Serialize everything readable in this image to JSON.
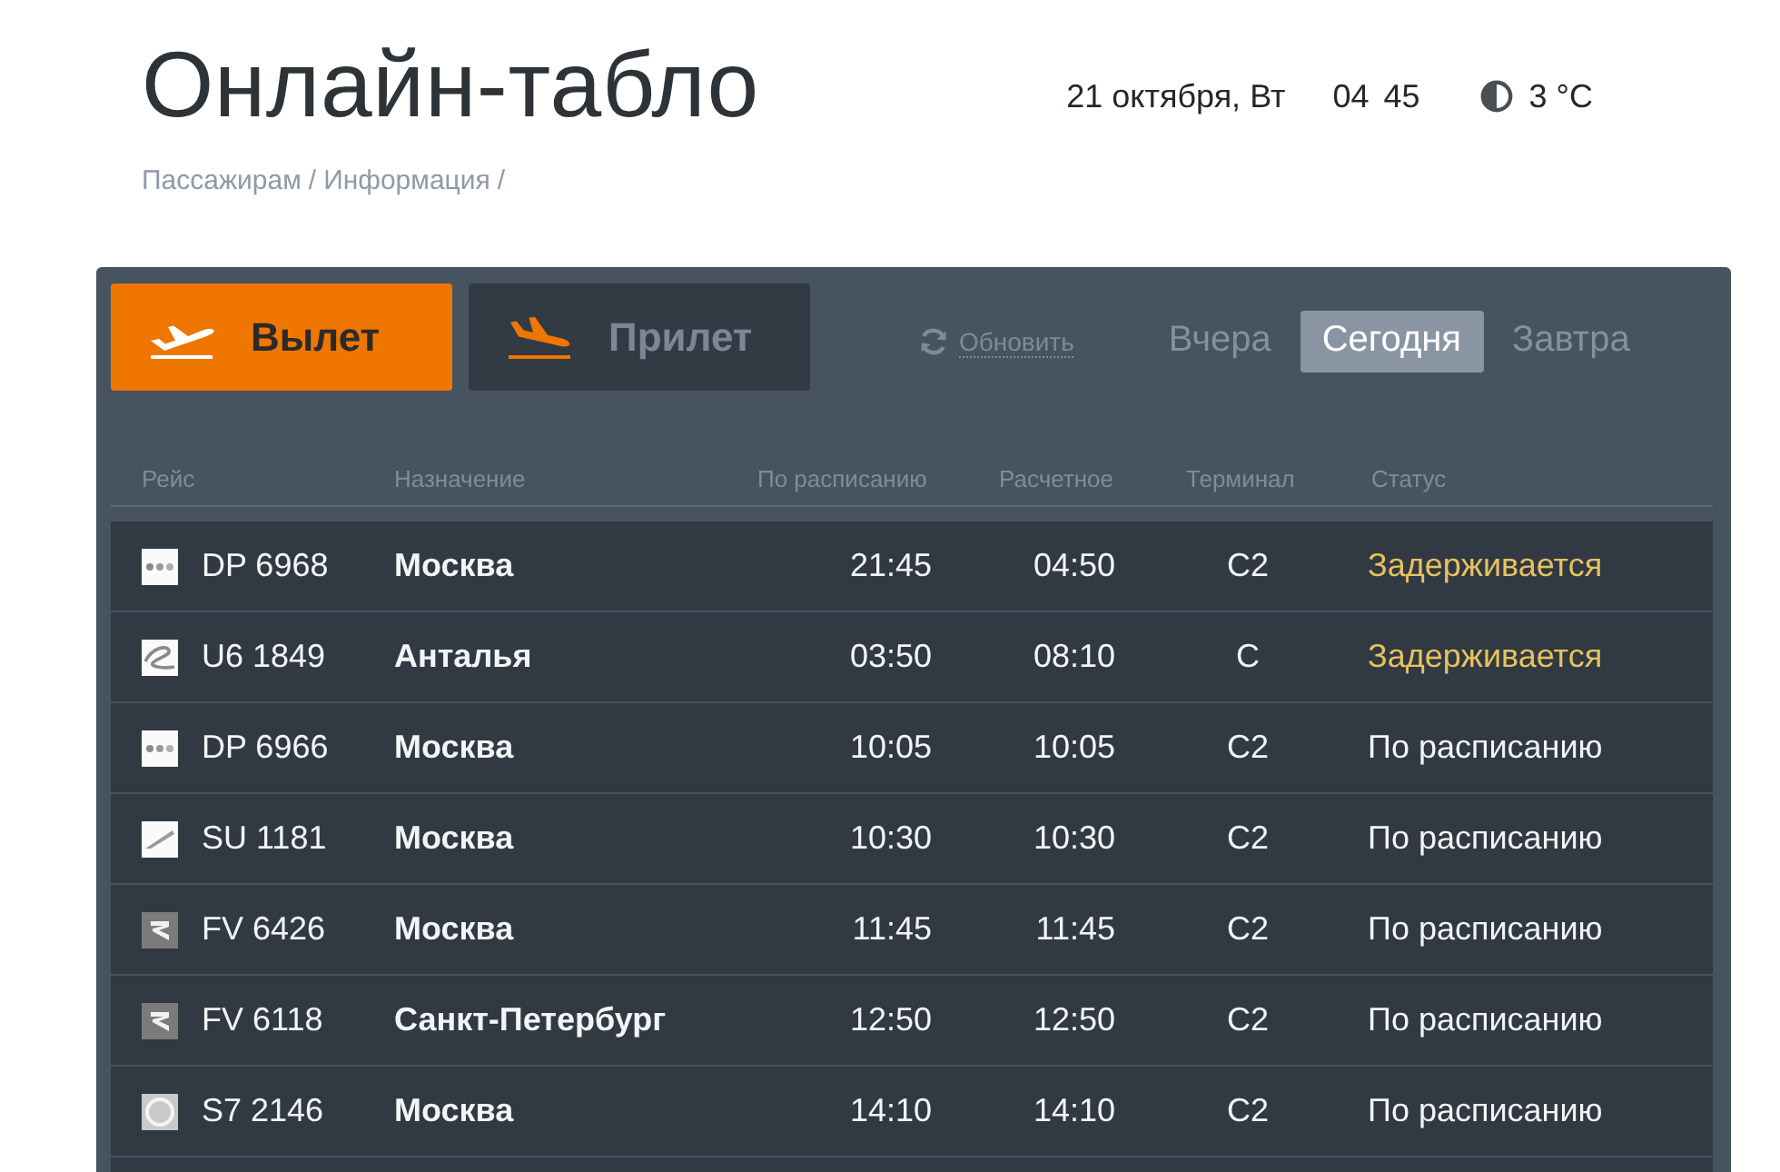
{
  "header": {
    "title": "Онлайн-табло",
    "date": "21 октября, Вт",
    "clock": {
      "hours": "04",
      "minutes": "45"
    },
    "temperature": "3 °C"
  },
  "breadcrumb": {
    "items": [
      "Пассажирам",
      "Информация"
    ],
    "separator": "/"
  },
  "board": {
    "direction_tabs": [
      {
        "label": "Вылет",
        "kind": "departure",
        "selected": true
      },
      {
        "label": "Прилет",
        "kind": "arrival",
        "selected": false
      }
    ],
    "refresh": "Обновить",
    "day_tabs": [
      {
        "label": "Вчера",
        "selected": false
      },
      {
        "label": "Сегодня",
        "selected": true
      },
      {
        "label": "Завтра",
        "selected": false
      }
    ],
    "columns": [
      "Рейс",
      "Назначение",
      "По расписанию",
      "Расчетное",
      "Терминал",
      "Статус"
    ],
    "rows": [
      {
        "kind": "dots",
        "flight": "DP 6968",
        "destination": "Москва",
        "scheduled": "21:45",
        "estimated": "04:50",
        "terminal": "C2",
        "status": "Задерживается",
        "delayed": true
      },
      {
        "kind": "swoosh",
        "flight": "U6 1849",
        "destination": "Анталья",
        "scheduled": "03:50",
        "estimated": "08:10",
        "terminal": "C",
        "status": "Задерживается",
        "delayed": true
      },
      {
        "kind": "dots",
        "flight": "DP 6966",
        "destination": "Москва",
        "scheduled": "10:05",
        "estimated": "10:05",
        "terminal": "C2",
        "status": "По расписанию",
        "delayed": false
      },
      {
        "kind": "wing",
        "flight": "SU 1181",
        "destination": "Москва",
        "scheduled": "10:30",
        "estimated": "10:30",
        "terminal": "C2",
        "status": "По расписанию",
        "delayed": false
      },
      {
        "kind": "chevron",
        "flight": "FV 6426",
        "destination": "Москва",
        "scheduled": "11:45",
        "estimated": "11:45",
        "terminal": "C2",
        "status": "По расписанию",
        "delayed": false
      },
      {
        "kind": "chevron",
        "flight": "FV 6118",
        "destination": "Санкт-Петербург",
        "scheduled": "12:50",
        "estimated": "12:50",
        "terminal": "C2",
        "status": "По расписанию",
        "delayed": false
      },
      {
        "kind": "ring",
        "flight": "S7 2146",
        "destination": "Москва",
        "scheduled": "14:10",
        "estimated": "14:10",
        "terminal": "C2",
        "status": "По расписанию",
        "delayed": false
      }
    ]
  }
}
